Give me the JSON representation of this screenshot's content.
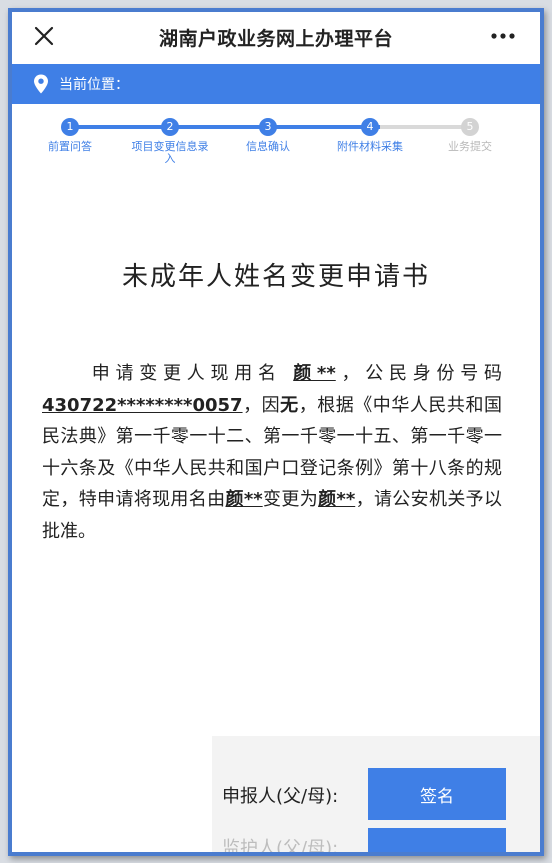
{
  "app": {
    "title": "湖南户政业务网上办理平台"
  },
  "location": {
    "label": "当前位置："
  },
  "steps": [
    {
      "num": "1",
      "label": "前置问答",
      "state": "done"
    },
    {
      "num": "2",
      "label": "项目变更信息录入",
      "state": "done"
    },
    {
      "num": "3",
      "label": "信息确认",
      "state": "done"
    },
    {
      "num": "4",
      "label": "附件材料采集",
      "state": "done"
    },
    {
      "num": "5",
      "label": "业务提交",
      "state": "todo"
    }
  ],
  "document": {
    "title": "未成年人姓名变更申请书",
    "p1": "申请变更人现用名",
    "current_name": "颜**",
    "p2": "，公民身份号码",
    "id_number": "430722********0057",
    "p3": "，因",
    "reason": "无",
    "p4": "，根据《中华人民共和国民法典》第一千零一十二、第一千零一十五、第一千零一十六条及《中华人民共和国户口登记条例》第十八条的规定，特申请将现用名由",
    "from_name": "颜**",
    "p5": "变更为",
    "to_name": "颜**",
    "p6": "，请公安机关予以批准。"
  },
  "footer": {
    "applicant_label": "申报人(父/母):",
    "sign_label": "签名",
    "next_label": "监护人(父/母):"
  },
  "colors": {
    "accent": "#3f7fe6",
    "frame": "#4a7ccf",
    "inactive": "#d3d3d3"
  }
}
